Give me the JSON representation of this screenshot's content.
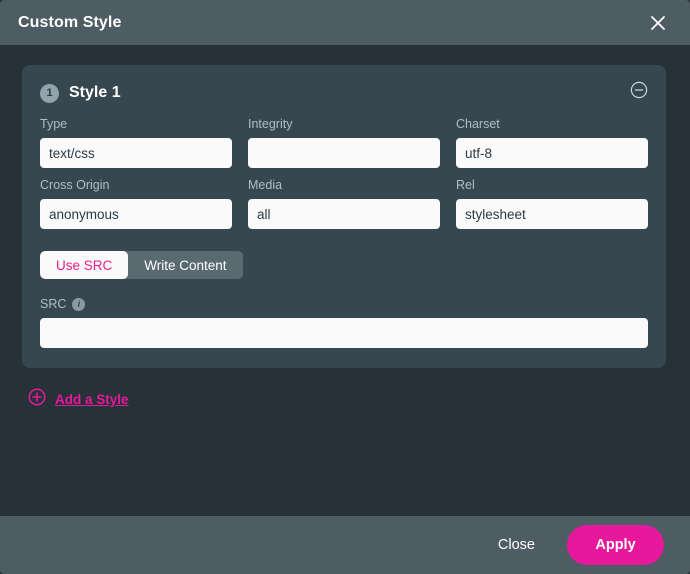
{
  "dialog": {
    "title": "Custom Style",
    "close_icon": "close-icon"
  },
  "style_card": {
    "badge": "1",
    "title": "Style 1",
    "collapse_icon": "circle-minus-icon",
    "fields": [
      {
        "label": "Type",
        "value": "text/css",
        "placeholder": ""
      },
      {
        "label": "Integrity",
        "value": "",
        "placeholder": ""
      },
      {
        "label": "Charset",
        "value": "utf-8",
        "placeholder": ""
      },
      {
        "label": "Cross Origin",
        "value": "anonymous",
        "placeholder": ""
      },
      {
        "label": "Media",
        "value": "all",
        "placeholder": ""
      },
      {
        "label": "Rel",
        "value": "stylesheet",
        "placeholder": ""
      }
    ],
    "toggle": {
      "use_src_label": "Use SRC",
      "write_content_label": "Write Content",
      "selected": "Use SRC"
    },
    "src": {
      "label": "SRC",
      "info_icon": "info-icon",
      "info_glyph": "i",
      "value": "",
      "placeholder": ""
    }
  },
  "add_style": {
    "label": "Add a Style",
    "icon": "circle-plus-icon"
  },
  "footer": {
    "close_label": "Close",
    "apply_label": "Apply"
  },
  "colors": {
    "accent": "#e6189b",
    "titlebar": "#4e5d63",
    "body": "#263238",
    "card": "#37474f",
    "input": "#fafafa",
    "label": "#b0bec5"
  }
}
